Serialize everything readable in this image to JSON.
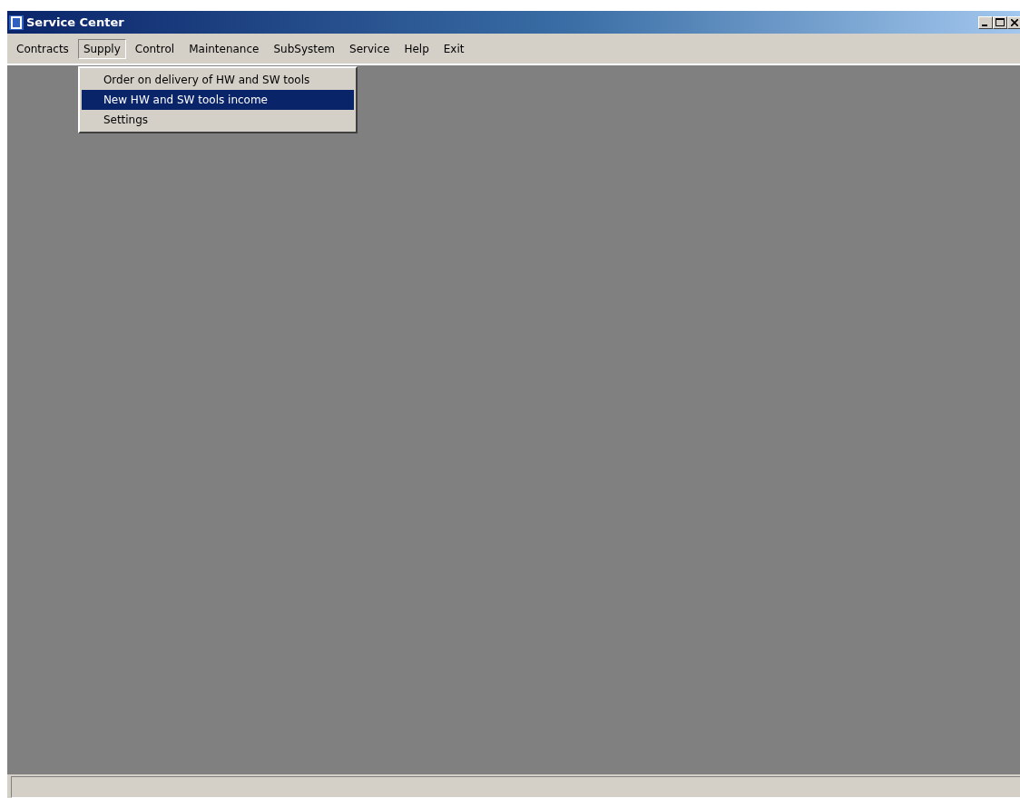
{
  "window": {
    "title": "Service Center"
  },
  "menu": [
    {
      "label": "Contracts",
      "selected": false
    },
    {
      "label": "Supply",
      "selected": true
    },
    {
      "label": "Control",
      "selected": false
    },
    {
      "label": "Maintenance",
      "selected": false
    },
    {
      "label": "SubSystem",
      "selected": false
    },
    {
      "label": "Service",
      "selected": false
    },
    {
      "label": "Help",
      "selected": false
    },
    {
      "label": "Exit",
      "selected": false
    }
  ],
  "dropdown": {
    "items": [
      {
        "label": "Order on delivery of HW and SW tools",
        "selected": false
      },
      {
        "label": "New HW and SW tools income",
        "selected": true
      },
      {
        "label": "Settings",
        "selected": false
      }
    ]
  }
}
